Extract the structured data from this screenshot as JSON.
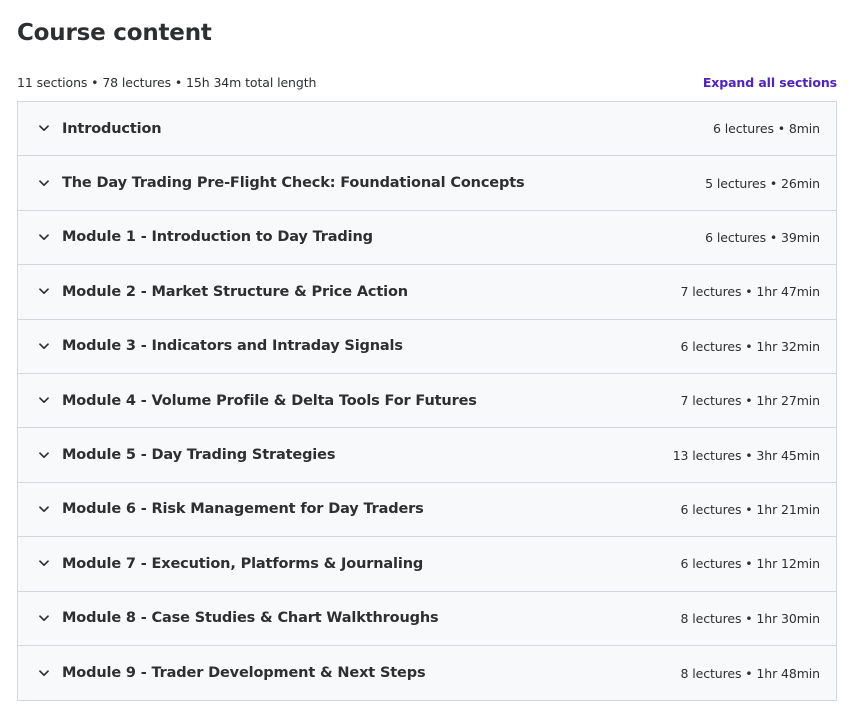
{
  "header": {
    "title": "Course content",
    "summary": "11 sections • 78 lectures • 15h 34m total length",
    "expand_all_label": "Expand all sections"
  },
  "colors": {
    "accent": "#5022c3",
    "row_background": "#f7f9fa",
    "border": "#d1d7dc",
    "text": "#2d2f31"
  },
  "sections": [
    {
      "title": "Introduction",
      "meta": "6 lectures • 8min",
      "icon": "chevron-down-icon"
    },
    {
      "title": "The Day Trading Pre-Flight Check: Foundational Concepts",
      "meta": "5 lectures • 26min",
      "icon": "chevron-down-icon"
    },
    {
      "title": "Module 1 - Introduction to Day Trading",
      "meta": "6 lectures • 39min",
      "icon": "chevron-down-icon"
    },
    {
      "title": "Module 2 - Market Structure & Price Action",
      "meta": "7 lectures • 1hr 47min",
      "icon": "chevron-down-icon"
    },
    {
      "title": "Module 3 - Indicators and Intraday Signals",
      "meta": "6 lectures • 1hr 32min",
      "icon": "chevron-down-icon"
    },
    {
      "title": "Module 4 - Volume Profile & Delta Tools For Futures",
      "meta": "7 lectures • 1hr 27min",
      "icon": "chevron-down-icon"
    },
    {
      "title": "Module 5 - Day Trading Strategies",
      "meta": "13 lectures • 3hr 45min",
      "icon": "chevron-down-icon"
    },
    {
      "title": "Module 6 - Risk Management for Day Traders",
      "meta": "6 lectures • 1hr 21min",
      "icon": "chevron-down-icon"
    },
    {
      "title": "Module 7 - Execution, Platforms & Journaling",
      "meta": "6 lectures • 1hr 12min",
      "icon": "chevron-down-icon"
    },
    {
      "title": "Module 8 - Case Studies & Chart Walkthroughs",
      "meta": "8 lectures • 1hr 30min",
      "icon": "chevron-down-icon"
    },
    {
      "title": "Module 9 - Trader Development & Next Steps",
      "meta": "8 lectures • 1hr 48min",
      "icon": "chevron-down-icon"
    }
  ]
}
